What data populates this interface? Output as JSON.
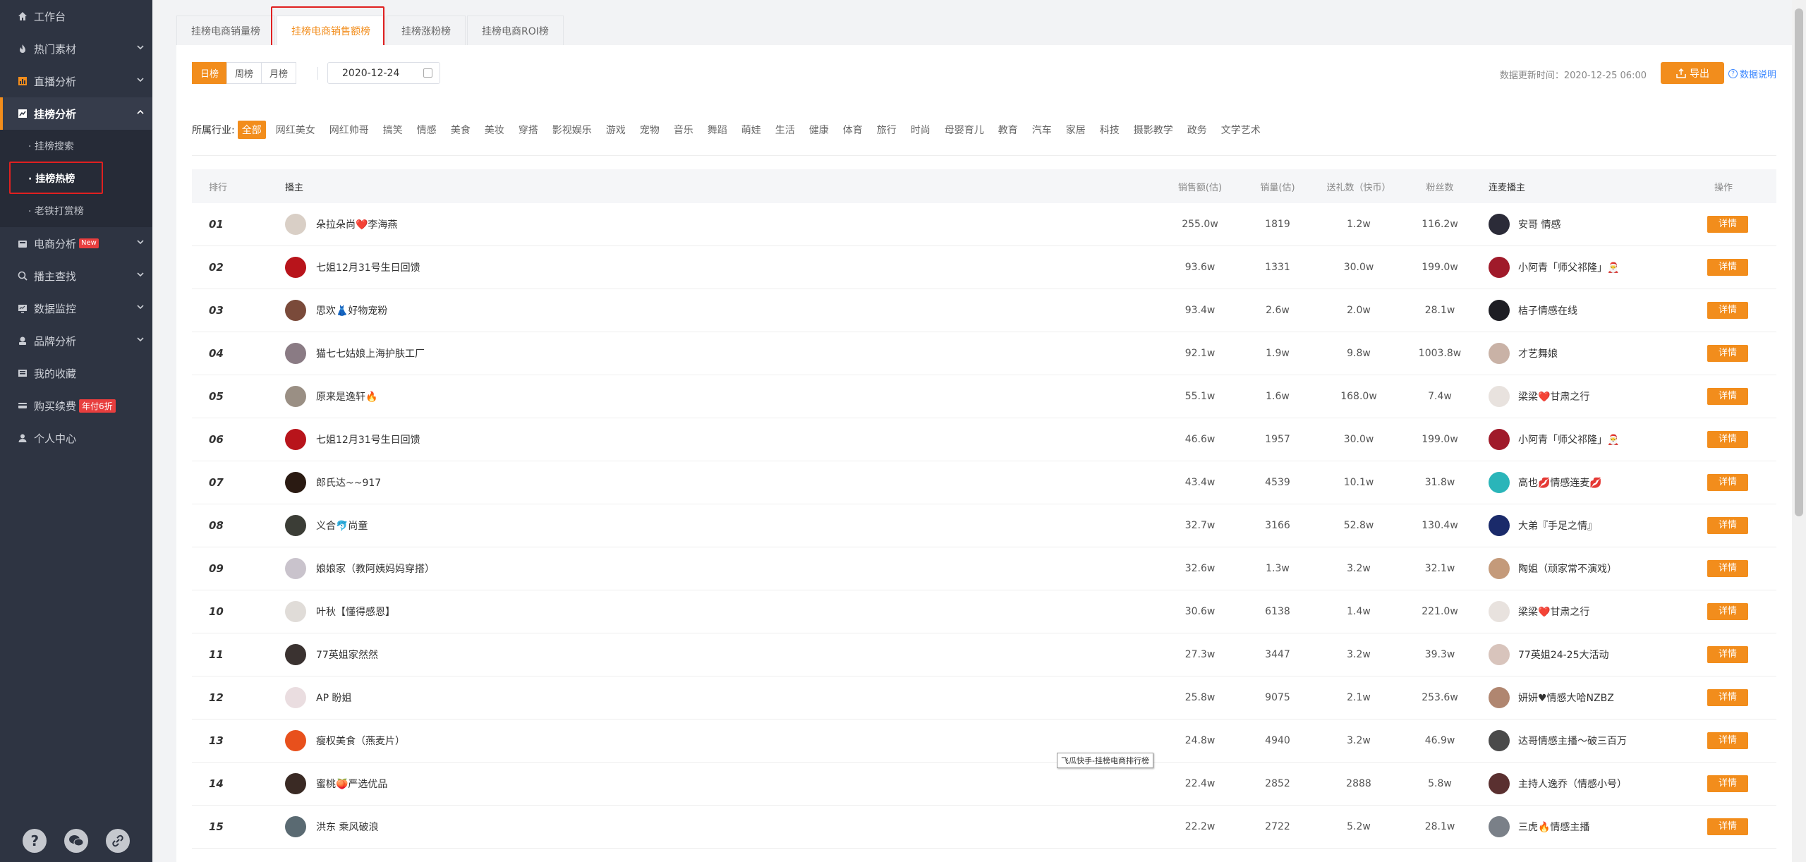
{
  "sidebar": {
    "items": [
      {
        "label": "工作台",
        "icon": "home-icon"
      },
      {
        "label": "热门素材",
        "icon": "fire-icon"
      },
      {
        "label": "直播分析",
        "icon": "bar-chart-icon"
      },
      {
        "label": "挂榜分析",
        "icon": "line-chart-icon"
      },
      {
        "label": "电商分析",
        "icon": "shop-icon",
        "badge": "New"
      },
      {
        "label": "播主查找",
        "icon": "search-icon"
      },
      {
        "label": "数据监控",
        "icon": "monitor-icon"
      },
      {
        "label": "品牌分析",
        "icon": "brand-icon"
      },
      {
        "label": "我的收藏",
        "icon": "favorite-icon"
      },
      {
        "label": "购买续费",
        "icon": "purchase-icon",
        "badge": "年付6折"
      },
      {
        "label": "个人中心",
        "icon": "user-icon"
      }
    ],
    "sub_items": [
      "· 挂榜搜索",
      "· 挂榜热榜",
      "· 老铁打赏榜"
    ],
    "bottom_icons": [
      "help-icon",
      "wechat-icon",
      "link-icon"
    ]
  },
  "tabs": [
    "挂榜电商销量榜",
    "挂榜电商销售额榜",
    "挂榜涨粉榜",
    "挂榜电商ROI榜"
  ],
  "toolbar": {
    "periods": [
      "日榜",
      "周榜",
      "月榜"
    ],
    "date": "2020-12-24",
    "update_time": "数据更新时间：2020-12-25 06:00",
    "export_label": "导出",
    "help_label": "数据说明"
  },
  "industry": {
    "label": "所属行业:",
    "tags": [
      "全部",
      "网红美女",
      "网红帅哥",
      "搞笑",
      "情感",
      "美食",
      "美妆",
      "穿搭",
      "影视娱乐",
      "游戏",
      "宠物",
      "音乐",
      "舞蹈",
      "萌娃",
      "生活",
      "健康",
      "体育",
      "旅行",
      "时尚",
      "母婴育儿",
      "教育",
      "汽车",
      "家居",
      "科技",
      "摄影教学",
      "政务",
      "文学艺术"
    ]
  },
  "table": {
    "headers": [
      "排行",
      "播主",
      "销售额(估)",
      "销量(估)",
      "送礼数（快币）",
      "粉丝数",
      "连麦播主",
      "操作"
    ],
    "detail_label": "详情",
    "rows": [
      {
        "rank": "01",
        "anchor": "朵拉朵尚❤️李海燕",
        "sales": "255.0w",
        "qty": "1819",
        "gift": "1.2w",
        "fans": "116.2w",
        "linked": "安哥 情感",
        "a_color": "#d9cfc6",
        "l_color": "#2b2b38"
      },
      {
        "rank": "02",
        "anchor": "七姐12月31号生日回馈",
        "sales": "93.6w",
        "qty": "1331",
        "gift": "30.0w",
        "fans": "199.0w",
        "linked": "小阿青「师父祁隆」🎅",
        "a_color": "#b8141b",
        "l_color": "#a01a2a"
      },
      {
        "rank": "03",
        "anchor": "思欢👗好物宠粉",
        "sales": "93.4w",
        "qty": "2.6w",
        "gift": "2.0w",
        "fans": "28.1w",
        "linked": "桔子情感在线",
        "a_color": "#7a4a3a",
        "l_color": "#1e1e24"
      },
      {
        "rank": "04",
        "anchor": "猫七七姑娘上海护肤工厂",
        "sales": "92.1w",
        "qty": "1.9w",
        "gift": "9.8w",
        "fans": "1003.8w",
        "linked": "才艺舞娘",
        "a_color": "#8a7b84",
        "l_color": "#c9b2a6"
      },
      {
        "rank": "05",
        "anchor": "原来是逸轩🔥",
        "sales": "55.1w",
        "qty": "1.6w",
        "gift": "168.0w",
        "fans": "7.4w",
        "linked": "梁梁❤️甘肃之行",
        "a_color": "#9a8f84",
        "l_color": "#e8e2de"
      },
      {
        "rank": "06",
        "anchor": "七姐12月31号生日回馈",
        "sales": "46.6w",
        "qty": "1957",
        "gift": "30.0w",
        "fans": "199.0w",
        "linked": "小阿青「师父祁隆」🎅",
        "a_color": "#b8141b",
        "l_color": "#a01a2a"
      },
      {
        "rank": "07",
        "anchor": "郎氏达~~917",
        "sales": "43.4w",
        "qty": "4539",
        "gift": "10.1w",
        "fans": "31.8w",
        "linked": "高也💋情感连麦💋",
        "a_color": "#2a1a12",
        "l_color": "#2ab5b9"
      },
      {
        "rank": "08",
        "anchor": "义合🐬尚童",
        "sales": "32.7w",
        "qty": "3166",
        "gift": "52.8w",
        "fans": "130.4w",
        "linked": "大弟『手足之情』",
        "a_color": "#3b3d36",
        "l_color": "#1a2a6a"
      },
      {
        "rank": "09",
        "anchor": "娘娘家（教阿姨妈妈穿搭）",
        "sales": "32.6w",
        "qty": "1.3w",
        "gift": "3.2w",
        "fans": "32.1w",
        "linked": "陶姐（顽家常不演戏）",
        "a_color": "#c9c3cc",
        "l_color": "#c49a7a"
      },
      {
        "rank": "10",
        "anchor": "叶秋【懂得感恩】",
        "sales": "30.6w",
        "qty": "6138",
        "gift": "1.4w",
        "fans": "221.0w",
        "linked": "梁梁❤️甘肃之行",
        "a_color": "#e0dcd8",
        "l_color": "#e8e2de"
      },
      {
        "rank": "11",
        "anchor": "77英姐家然然",
        "sales": "27.3w",
        "qty": "3447",
        "gift": "3.2w",
        "fans": "39.3w",
        "linked": "77英姐24-25大活动",
        "a_color": "#3a3230",
        "l_color": "#d8c4bc"
      },
      {
        "rank": "12",
        "anchor": "AP 盼姐",
        "sales": "25.8w",
        "qty": "9075",
        "gift": "2.1w",
        "fans": "253.6w",
        "linked": "妍妍♥情感大哈NZBZ",
        "a_color": "#eadde0",
        "l_color": "#b08670"
      },
      {
        "rank": "13",
        "anchor": "瘦权美食（燕麦片）",
        "sales": "24.8w",
        "qty": "4940",
        "gift": "3.2w",
        "fans": "46.9w",
        "linked": "达哥情感主播～破三百万",
        "a_color": "#e8501c",
        "l_color": "#4a4a4a"
      },
      {
        "rank": "14",
        "anchor": "蜜桃🍑严选优品",
        "sales": "22.4w",
        "qty": "2852",
        "gift": "2888",
        "fans": "5.8w",
        "linked": "主持人逸乔（情感小号）",
        "a_color": "#3a2a24",
        "l_color": "#5a3030"
      },
      {
        "rank": "15",
        "anchor": "洪东 乘风破浪",
        "sales": "22.2w",
        "qty": "2722",
        "gift": "5.2w",
        "fans": "28.1w",
        "linked": "三虎🔥情感主播",
        "a_color": "#5a6a72",
        "l_color": "#7a8088"
      }
    ]
  },
  "tooltip": "飞瓜快手-挂榜电商排行榜",
  "colors": {
    "accent": "#f28d1c",
    "sidebar_bg": "#2e3442",
    "highlight_border": "#e02020"
  }
}
